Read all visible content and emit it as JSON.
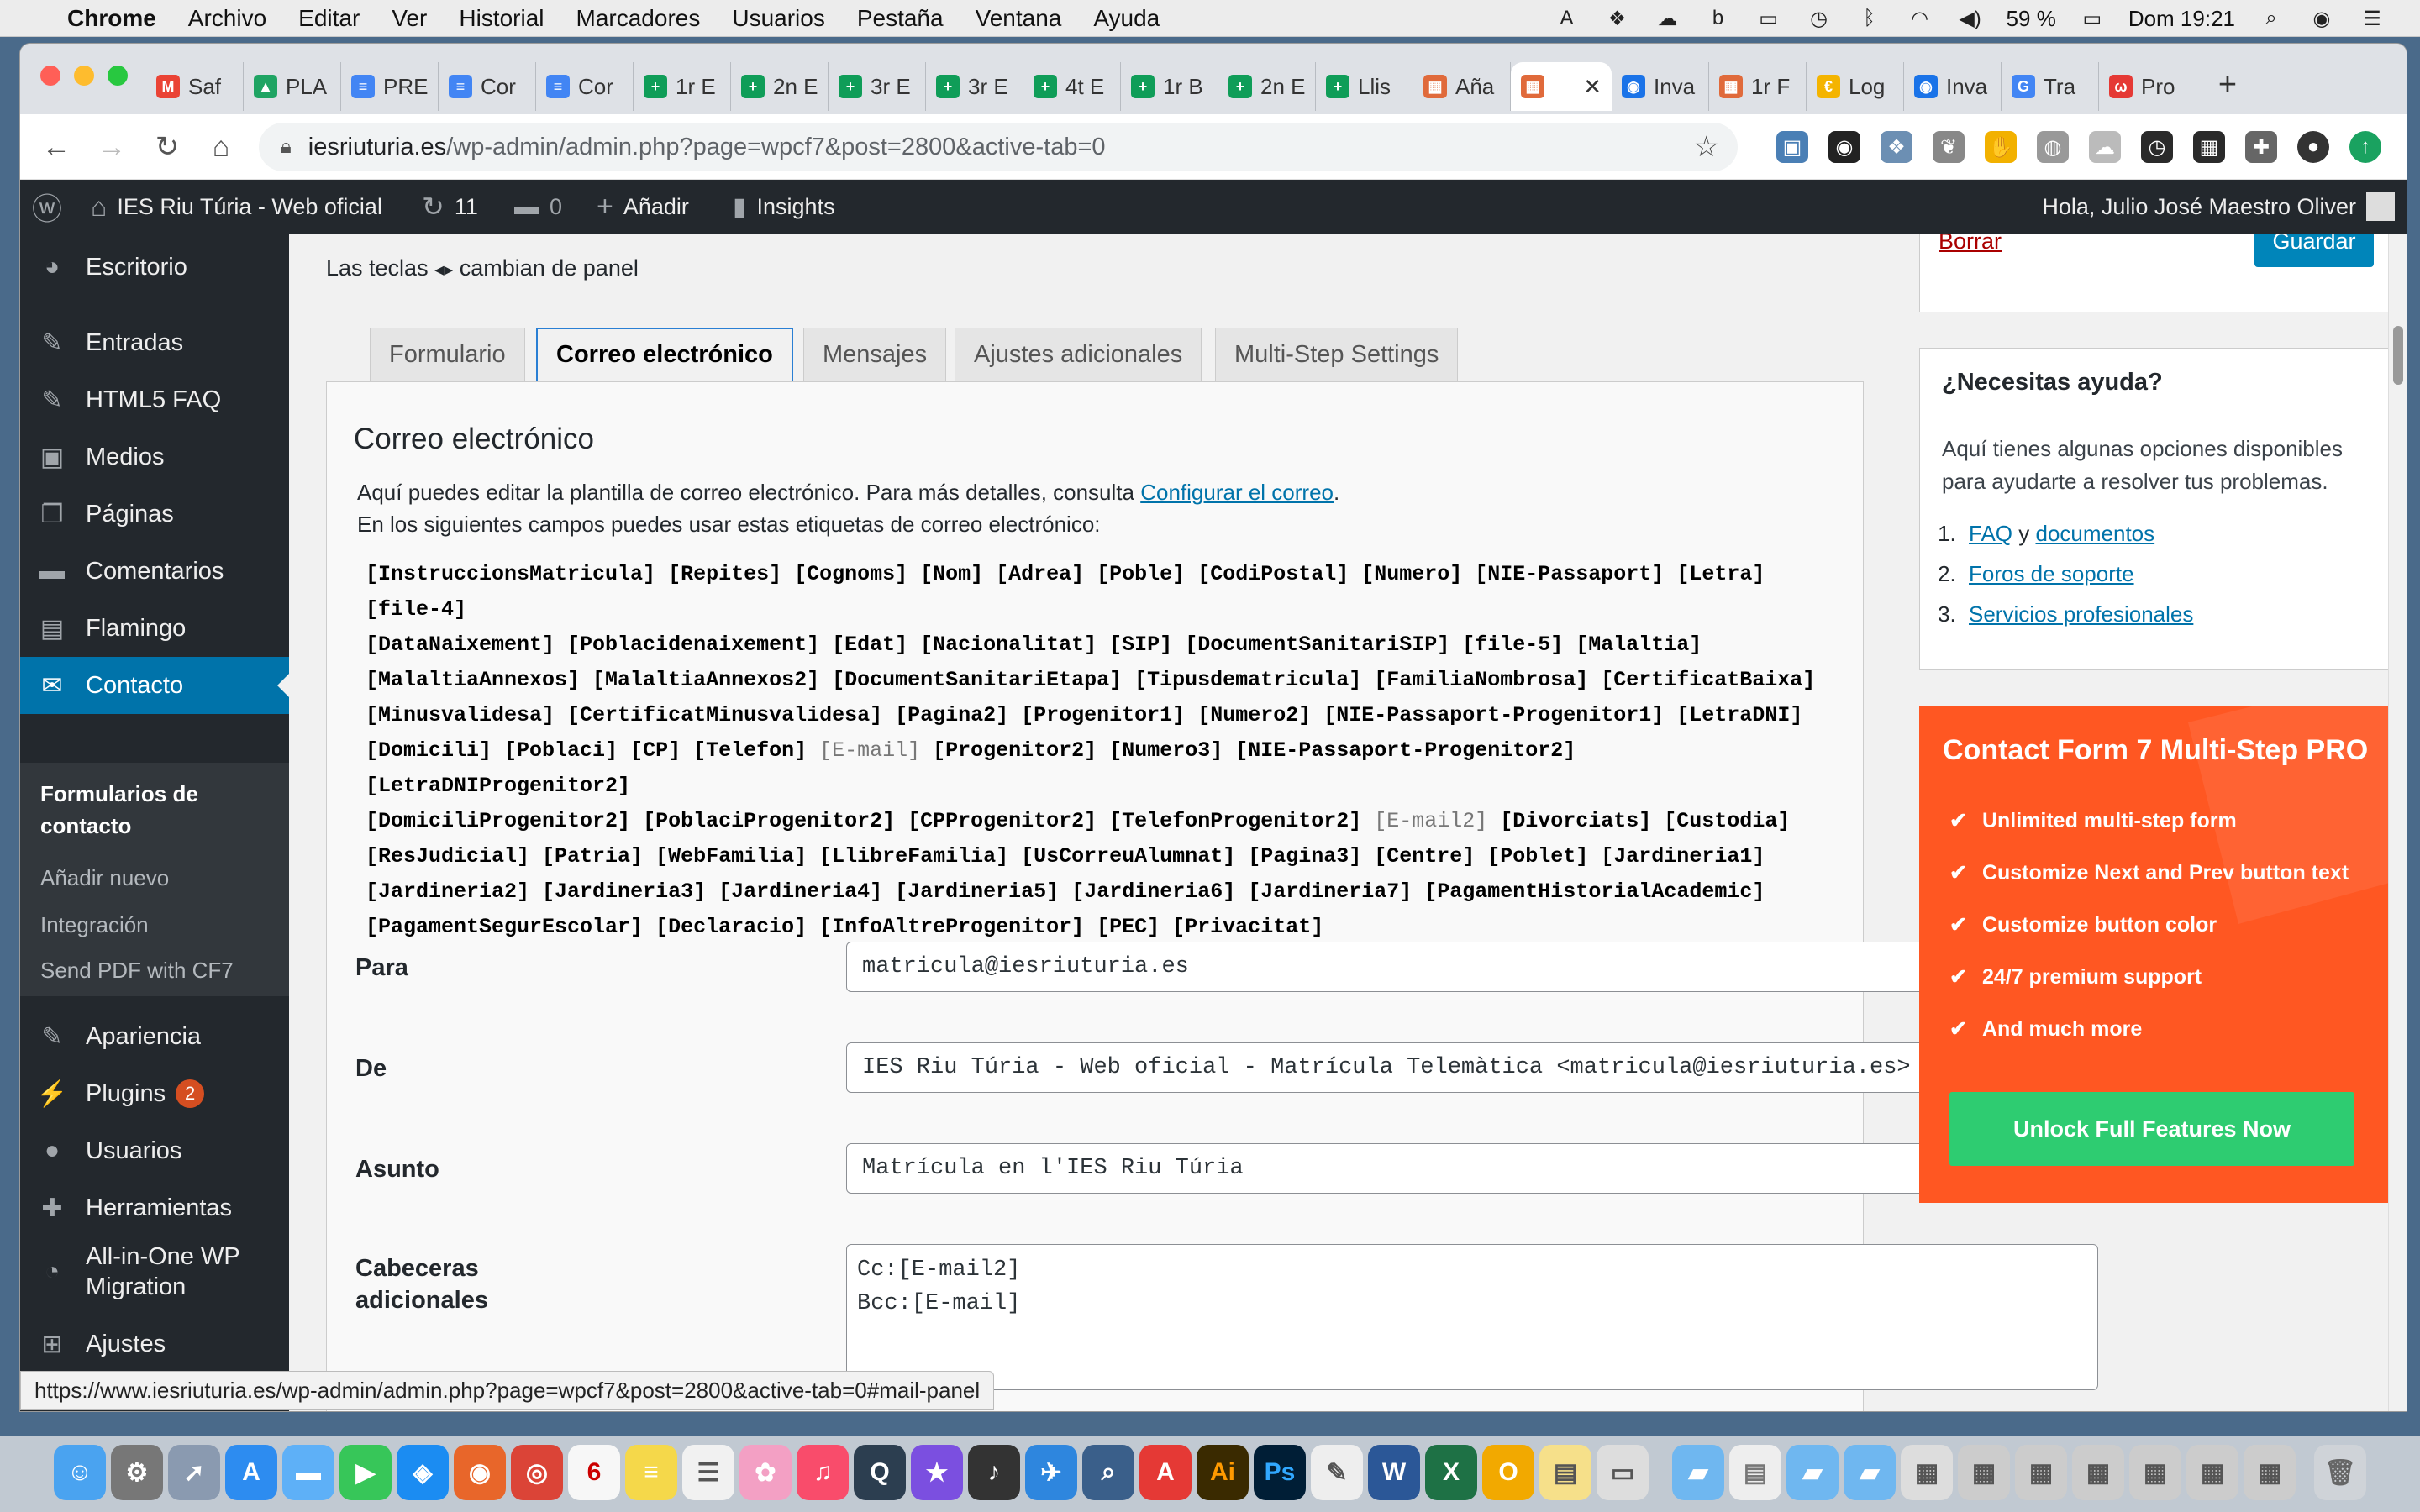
{
  "menubar": {
    "app": "Chrome",
    "items": [
      "Archivo",
      "Editar",
      "Ver",
      "Historial",
      "Marcadores",
      "Usuarios",
      "Pestaña",
      "Ventana",
      "Ayuda"
    ],
    "battery": "59 %",
    "clock": "Dom 19:21"
  },
  "tabs": [
    {
      "label": "Saf",
      "icon": "gmail-icon",
      "color": "#ea4335",
      "glyph": "M"
    },
    {
      "label": "PLA",
      "icon": "drive-icon",
      "color": "#1fa463",
      "glyph": "▲"
    },
    {
      "label": "PRE",
      "icon": "docs-icon",
      "color": "#4285f4",
      "glyph": "≡"
    },
    {
      "label": "Cor",
      "icon": "docs-icon",
      "color": "#4285f4",
      "glyph": "≡"
    },
    {
      "label": "Cor",
      "icon": "docs-icon",
      "color": "#4285f4",
      "glyph": "≡"
    },
    {
      "label": "1r E",
      "icon": "sheets-icon",
      "color": "#0f9d58",
      "glyph": "+"
    },
    {
      "label": "2n E",
      "icon": "sheets-icon",
      "color": "#0f9d58",
      "glyph": "+"
    },
    {
      "label": "3r E",
      "icon": "sheets-icon",
      "color": "#0f9d58",
      "glyph": "+"
    },
    {
      "label": "3r E",
      "icon": "sheets-icon",
      "color": "#0f9d58",
      "glyph": "+"
    },
    {
      "label": "4t E",
      "icon": "sheets-icon",
      "color": "#0f9d58",
      "glyph": "+"
    },
    {
      "label": "1r B",
      "icon": "sheets-icon",
      "color": "#0f9d58",
      "glyph": "+"
    },
    {
      "label": "2n E",
      "icon": "sheets-icon",
      "color": "#0f9d58",
      "glyph": "+"
    },
    {
      "label": "Llis",
      "icon": "sheets-icon",
      "color": "#0f9d58",
      "glyph": "+"
    },
    {
      "label": "Aña",
      "icon": "site-icon",
      "color": "#e06a3b",
      "glyph": "▦"
    },
    {
      "label": "",
      "icon": "site-icon",
      "color": "#e06a3b",
      "glyph": "▦",
      "active": true
    },
    {
      "label": "Inva",
      "icon": "globe-icon",
      "color": "#1a73e8",
      "glyph": "◉"
    },
    {
      "label": "1r F",
      "icon": "site-icon",
      "color": "#e06a3b",
      "glyph": "▦"
    },
    {
      "label": "Log",
      "icon": "yellow-icon",
      "color": "#f4b400",
      "glyph": "€"
    },
    {
      "label": "Inva",
      "icon": "globe-icon",
      "color": "#1a73e8",
      "glyph": "◉"
    },
    {
      "label": "Tra",
      "icon": "translate-icon",
      "color": "#4285f4",
      "glyph": "G"
    },
    {
      "label": "Pro",
      "icon": "red-icon",
      "color": "#e53935",
      "glyph": "ω"
    }
  ],
  "url": {
    "host": "iesriuturia.es",
    "path": "/wp-admin/admin.php?page=wpcf7&post=2800&active-tab=0"
  },
  "adminbar": {
    "site": "IES Riu Túria - Web oficial",
    "updates": "11",
    "comments": "0",
    "add": "Añadir",
    "insights": "Insights",
    "greeting": "Hola, Julio José Maestro Oliver"
  },
  "sidebar": {
    "items": [
      {
        "label": "Escritorio",
        "icon": "dashboard-icon",
        "glyph": "◕"
      },
      {
        "label": "Entradas",
        "icon": "pin-icon",
        "glyph": "✎"
      },
      {
        "label": "HTML5 FAQ",
        "icon": "pin-icon",
        "glyph": "✎"
      },
      {
        "label": "Medios",
        "icon": "media-icon",
        "glyph": "▣"
      },
      {
        "label": "Páginas",
        "icon": "pages-icon",
        "glyph": "❐"
      },
      {
        "label": "Comentarios",
        "icon": "comment-icon",
        "glyph": "▬"
      },
      {
        "label": "Flamingo",
        "icon": "flamingo-icon",
        "glyph": "▤"
      },
      {
        "label": "Contacto",
        "icon": "mail-icon",
        "glyph": "✉"
      },
      {
        "label": "Apariencia",
        "icon": "brush-icon",
        "glyph": "✎"
      },
      {
        "label": "Plugins",
        "icon": "plugin-icon",
        "glyph": "⚡",
        "badge": "2"
      },
      {
        "label": "Usuarios",
        "icon": "users-icon",
        "glyph": "●"
      },
      {
        "label": "Herramientas",
        "icon": "wrench-icon",
        "glyph": "✚"
      },
      {
        "label": "All-in-One WP Migration",
        "icon": "migration-icon",
        "glyph": "◔"
      },
      {
        "label": "Ajustes",
        "icon": "settings-icon",
        "glyph": "⊞"
      }
    ],
    "submenu": [
      "Formularios de contacto",
      "Añadir nuevo",
      "Integración",
      "Send PDF with CF7"
    ]
  },
  "content": {
    "topbox": {
      "delete": "Borrar",
      "save": "Guardar"
    },
    "keyhint": {
      "before": "Las teclas",
      "arrows": "◂▸",
      "after": "cambian de panel"
    },
    "tabs": [
      "Formulario",
      "Correo electrónico",
      "Mensajes",
      "Ajustes adicionales",
      "Multi-Step Settings"
    ],
    "panel": {
      "title": "Correo electrónico",
      "desc1": "Aquí puedes editar la plantilla de correo electrónico. Para más detalles, consulta",
      "desc1_link": "Configurar el correo",
      "desc2": "En los siguientes campos puedes usar estas etiquetas de correo electrónico:",
      "tags": [
        [
          "[InstruccionsMatricula]",
          "[Repites]",
          "[Cognoms]",
          "[Nom]",
          "[Adrea]",
          "[Poble]",
          "[CodiPostal]",
          "[Numero]",
          "[NIE-Passaport]",
          "[Letra]",
          "[file-4]"
        ],
        [
          "[DataNaixement]",
          "[Poblacidenaixement]",
          "[Edat]",
          "[Nacionalitat]",
          "[SIP]",
          "[DocumentSanitariSIP]",
          "[file-5]",
          "[Malaltia]"
        ],
        [
          "[MalaltiaAnnexos]",
          "[MalaltiaAnnexos2]",
          "[DocumentSanitariEtapa]",
          "[Tipusdematricula]",
          "[FamiliaNombrosa]",
          "[CertificatBaixa]"
        ],
        [
          "[Minusvalidesa]",
          "[CertificatMinusvalidesa]",
          "[Pagina2]",
          "[Progenitor1]",
          "[Numero2]",
          "[NIE-Passaport-Progenitor1]",
          "[LetraDNI]"
        ],
        [
          "[Domicili]",
          "[Poblaci]",
          "[CP]",
          "[Telefon]",
          "~[E-mail]",
          "[Progenitor2]",
          "[Numero3]",
          "[NIE-Passaport-Progenitor2]",
          "[LetraDNIProgenitor2]"
        ],
        [
          "[DomiciliProgenitor2]",
          "[PoblaciProgenitor2]",
          "[CPProgenitor2]",
          "[TelefonProgenitor2]",
          "~[E-mail2]",
          "[Divorciats]",
          "[Custodia]"
        ],
        [
          "[ResJudicial]",
          "[Patria]",
          "[WebFamilia]",
          "[LlibreFamilia]",
          "[UsCorreuAlumnat]",
          "[Pagina3]",
          "[Centre]",
          "[Poblet]",
          "[Jardineria1]"
        ],
        [
          "[Jardineria2]",
          "[Jardineria3]",
          "[Jardineria4]",
          "[Jardineria5]",
          "[Jardineria6]",
          "[Jardineria7]",
          "[PagamentHistorialAcademic]"
        ],
        [
          "[PagamentSegurEscolar]",
          "[Declaracio]",
          "[InfoAltreProgenitor]",
          "[PEC]",
          "[Privacitat]"
        ]
      ],
      "fields": {
        "to_label": "Para",
        "to_value": "matricula@iesriuturia.es",
        "from_label": "De",
        "from_value": "IES Riu Túria - Web oficial - Matrícula Telemàtica <matricula@iesriuturia.es>",
        "subject_label": "Asunto",
        "subject_value": "Matrícula en l'IES Riu Túria",
        "headers_label_1": "Cabeceras",
        "headers_label_2": "adicionales",
        "headers_line_1": "Cc:[E-mail2]",
        "headers_line_2": "Bcc:[E-mail]"
      }
    },
    "help": {
      "title": "¿Necesitas ayuda?",
      "desc": "Aquí tienes algunas opciones disponibles para ayudarte a resolver tus problemas.",
      "faq": "FAQ",
      "and": "y",
      "docs": "documentos",
      "forums": "Foros de soporte",
      "services": "Servicios profesionales"
    },
    "promo": {
      "title": "Contact Form 7 Multi-Step PRO",
      "features": [
        "Unlimited multi-step form",
        "Customize Next and Prev button text",
        "Customize button color",
        "24/7 premium support",
        "And much more"
      ],
      "button": "Unlock Full Features Now",
      "color": "#ff5722",
      "button_color": "#2ecc71"
    }
  },
  "statusbar": "https://www.iesriuturia.es/wp-admin/admin.php?page=wpcf7&post=2800&active-tab=0#mail-panel",
  "colors": {
    "wp_dark": "#23282d",
    "wp_blue": "#0073aa",
    "tab_active_border": "#2a7fd4"
  }
}
